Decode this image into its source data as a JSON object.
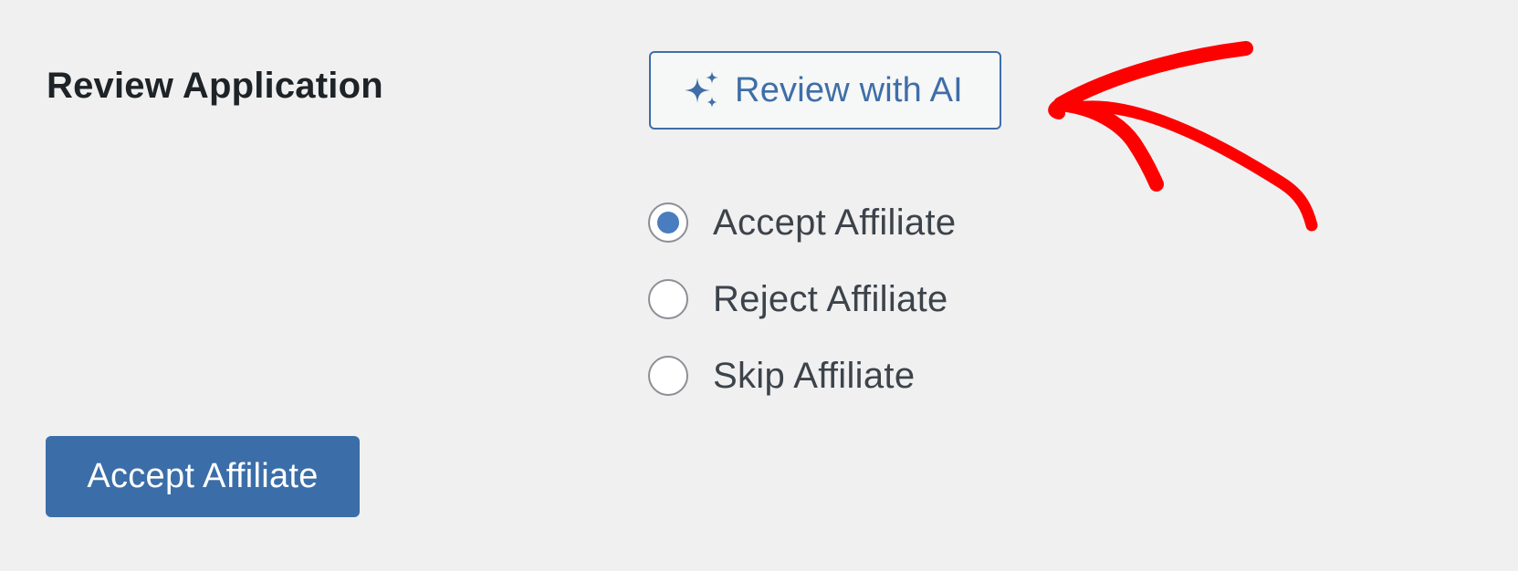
{
  "section": {
    "title": "Review Application"
  },
  "ai_review": {
    "label": "Review with AI",
    "icon": "sparkle-icon",
    "color": "#3f6ea8"
  },
  "options": [
    {
      "label": "Accept Affiliate",
      "selected": true
    },
    {
      "label": "Reject Affiliate",
      "selected": false
    },
    {
      "label": "Skip Affiliate",
      "selected": false
    }
  ],
  "submit": {
    "label": "Accept Affiliate",
    "color": "#3b6ea8"
  },
  "annotation": {
    "shape": "hand-drawn-arrow",
    "color": "#ff0000"
  }
}
